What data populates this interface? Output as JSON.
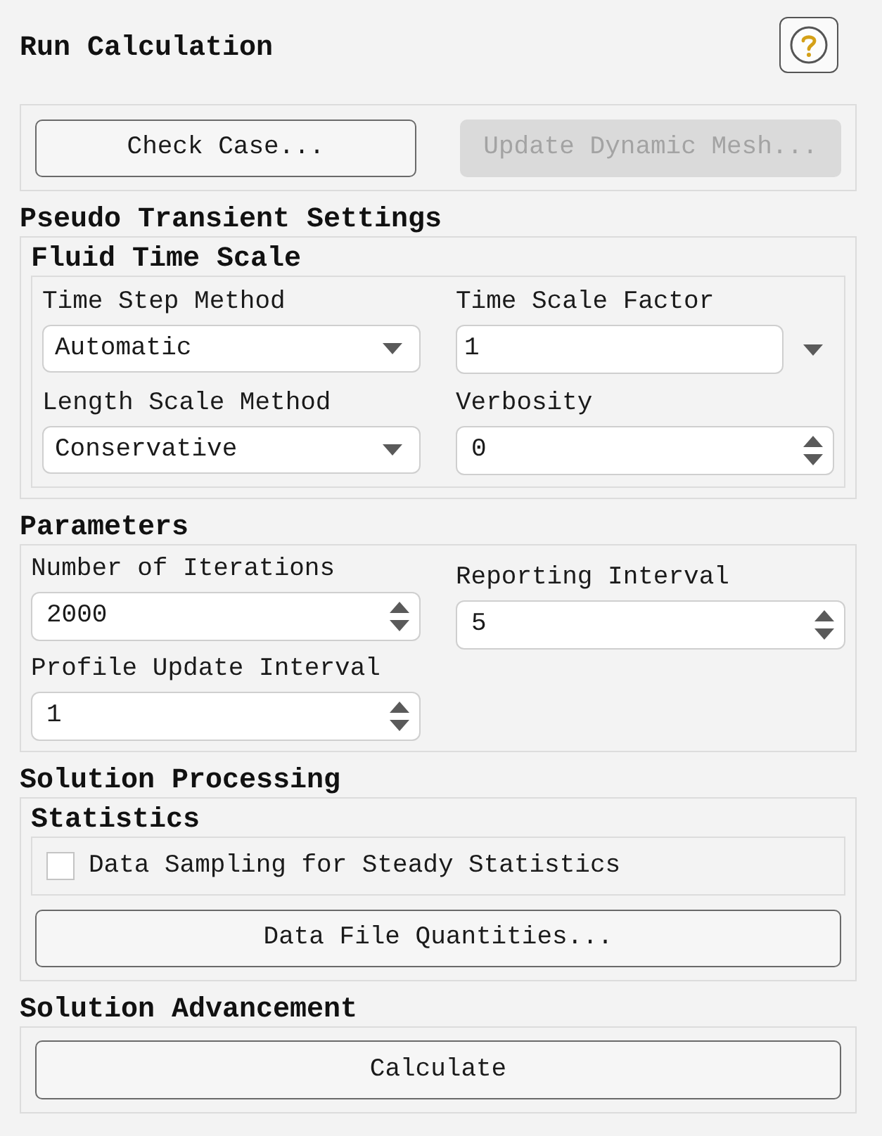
{
  "header": {
    "title": "Run Calculation"
  },
  "actions": [
    {
      "label": "Check Case...",
      "disabled": false
    },
    {
      "label": "Update Dynamic Mesh...",
      "disabled": true
    }
  ],
  "pseudo_transient_settings": {
    "title": "Pseudo Transient Settings",
    "fluid_time_scale": {
      "title": "Fluid Time Scale",
      "fields": [
        {
          "label": "Time Step Method",
          "kind": "dropdown",
          "value": "Automatic"
        },
        {
          "label": "Time Scale Factor",
          "kind": "text_menu",
          "value": "1"
        },
        {
          "label": "Length Scale Method",
          "kind": "dropdown",
          "value": "Conservative"
        },
        {
          "label": "Verbosity",
          "kind": "spinner",
          "value": "0"
        }
      ]
    }
  },
  "parameters": {
    "title": "Parameters",
    "columns": [
      [
        {
          "label": "Number of Iterations",
          "kind": "spinner",
          "value": "2000"
        },
        {
          "label": "Profile Update Interval",
          "kind": "spinner",
          "value": "1"
        }
      ],
      [
        {
          "label": "Reporting Interval",
          "kind": "spinner",
          "value": "5"
        }
      ]
    ]
  },
  "solution_processing": {
    "title": "Solution Processing",
    "statistics": {
      "title": "Statistics",
      "options": [
        {
          "label": "Data Sampling for Steady Statistics",
          "checked": false
        }
      ]
    },
    "buttons": [
      {
        "label": "Data File Quantities...",
        "disabled": false
      }
    ]
  },
  "solution_advancement": {
    "title": "Solution Advancement",
    "buttons": [
      {
        "label": "Calculate",
        "disabled": false
      }
    ]
  }
}
